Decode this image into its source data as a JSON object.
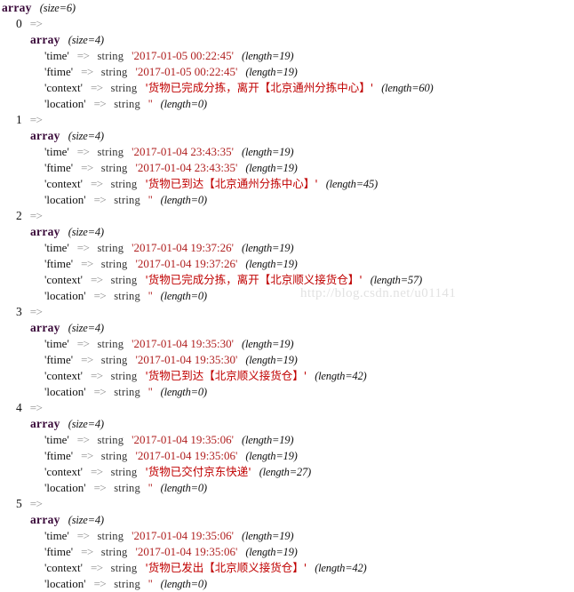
{
  "root": {
    "type_label": "array",
    "meta": "(size=6)"
  },
  "labels": {
    "array": "array",
    "inner_meta": "(size=4)",
    "arrow": "=>",
    "type_string": "string",
    "quote": "'",
    "empty_string": "''",
    "length_19": "(length=19)",
    "length_0": "(length=0)"
  },
  "keys": {
    "time": "'time'",
    "ftime": "'ftime'",
    "context": "'context'",
    "location": "'location'"
  },
  "entries": [
    {
      "index": "0",
      "index_arrow": "=>",
      "meta": "(size=4)",
      "time": "'2017-01-05 00:22:45'",
      "time_len": "(length=19)",
      "ftime": "'2017-01-05 00:22:45'",
      "ftime_len": "(length=19)",
      "context": "'货物已完成分拣，离开【北京通州分拣中心】'",
      "context_len": "(length=60)",
      "location": "''",
      "location_len": "(length=0)"
    },
    {
      "index": "1",
      "index_arrow": "=>",
      "meta": "(size=4)",
      "time": "'2017-01-04 23:43:35'",
      "time_len": "(length=19)",
      "ftime": "'2017-01-04 23:43:35'",
      "ftime_len": "(length=19)",
      "context": "'货物已到达【北京通州分拣中心】'",
      "context_len": "(length=45)",
      "location": "''",
      "location_len": "(length=0)"
    },
    {
      "index": "2",
      "index_arrow": "=>",
      "meta": "(size=4)",
      "time": "'2017-01-04 19:37:26'",
      "time_len": "(length=19)",
      "ftime": "'2017-01-04 19:37:26'",
      "ftime_len": "(length=19)",
      "context": "'货物已完成分拣，离开【北京顺义接货仓】'",
      "context_len": "(length=57)",
      "location": "''",
      "location_len": "(length=0)"
    },
    {
      "index": "3",
      "index_arrow": "=>",
      "meta": "(size=4)",
      "time": "'2017-01-04 19:35:30'",
      "time_len": "(length=19)",
      "ftime": "'2017-01-04 19:35:30'",
      "ftime_len": "(length=19)",
      "context": "'货物已到达【北京顺义接货仓】'",
      "context_len": "(length=42)",
      "location": "''",
      "location_len": "(length=0)"
    },
    {
      "index": "4",
      "index_arrow": "=>",
      "meta": "(size=4)",
      "time": "'2017-01-04 19:35:06'",
      "time_len": "(length=19)",
      "ftime": "'2017-01-04 19:35:06'",
      "ftime_len": "(length=19)",
      "context": "'货物已交付京东快递'",
      "context_len": "(length=27)",
      "location": "''",
      "location_len": "(length=0)"
    },
    {
      "index": "5",
      "index_arrow": "=>",
      "meta": "(size=4)",
      "time": "'2017-01-04 19:35:06'",
      "time_len": "(length=19)",
      "ftime": "'2017-01-04 19:35:06'",
      "ftime_len": "(length=19)",
      "context": "'货物已发出【北京顺义接货仓】'",
      "context_len": "(length=42)",
      "location": "''",
      "location_len": "(length=0)"
    }
  ],
  "watermark": "http://blog.csdn.net/u01141"
}
